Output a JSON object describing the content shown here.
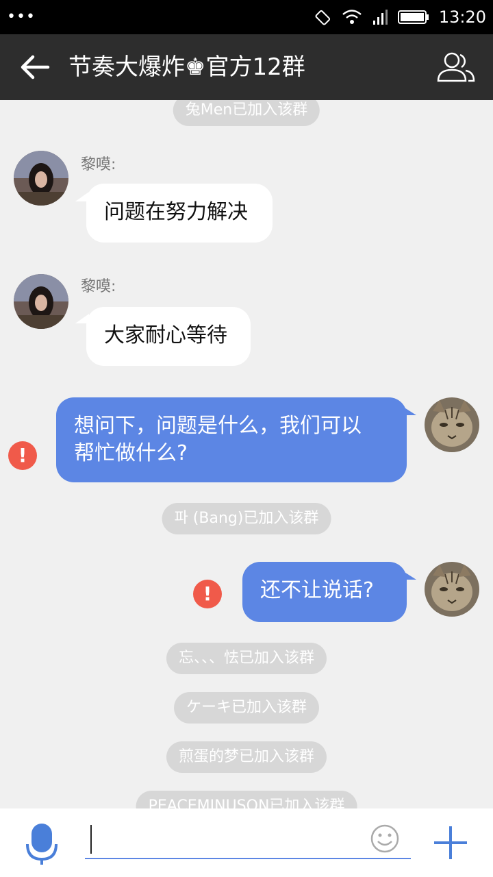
{
  "status_bar": {
    "time": "13:20",
    "dots": "•••"
  },
  "header": {
    "title": "节奏大爆炸♚官方12群"
  },
  "messages": {
    "sys_0": "兔Men已加入该群",
    "msg_1": {
      "sender": "黎嗼:",
      "text": "问题在努力解决"
    },
    "msg_2": {
      "sender": "黎嗼:",
      "text": "大家耐心等待"
    },
    "msg_3": {
      "text_line1": "想问下，问题是什么，我们可以",
      "text_line2": "帮忙做什么?"
    },
    "sys_4": "파 (Bang)已加入该群",
    "msg_5": {
      "text": "还不让说话?"
    },
    "sys_6": "忘、、、怯已加入该群",
    "sys_7": "ケーキ已加入该群",
    "sys_8": "煎蛋的梦已加入该群",
    "sys_9": "PEACEMINUSON已加入该群"
  },
  "input": {
    "value": "",
    "placeholder": ""
  },
  "colors": {
    "outgoing_bubble": "#5c86e4",
    "error": "#f05a4a",
    "title_bar": "#2d2d2d"
  },
  "icons": [
    "back-arrow-icon",
    "group-members-icon",
    "microphone-icon",
    "emoji-icon",
    "plus-icon",
    "error-icon",
    "wifi-icon",
    "signal-icon",
    "battery-icon",
    "rotate-icon"
  ]
}
